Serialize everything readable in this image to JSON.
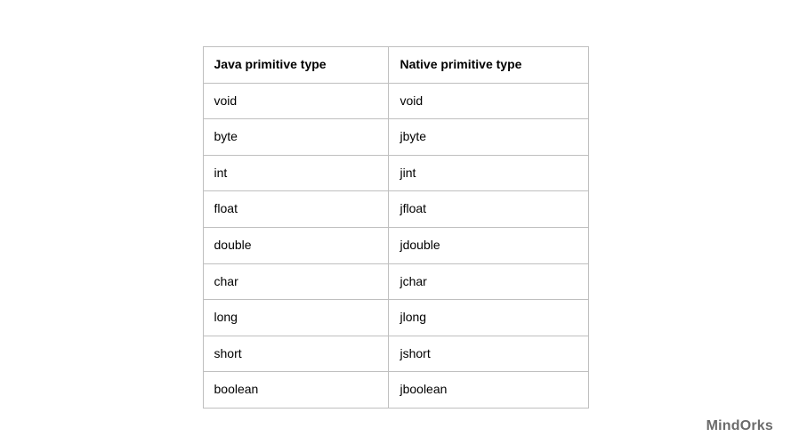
{
  "table": {
    "headers": [
      "Java primitive type",
      "Native primitive type"
    ],
    "rows": [
      {
        "java": "void",
        "native": "void"
      },
      {
        "java": "byte",
        "native": "jbyte"
      },
      {
        "java": "int",
        "native": "jint"
      },
      {
        "java": "float",
        "native": "jfloat"
      },
      {
        "java": "double",
        "native": "jdouble"
      },
      {
        "java": "char",
        "native": "jchar"
      },
      {
        "java": "long",
        "native": "jlong"
      },
      {
        "java": "short",
        "native": "jshort"
      },
      {
        "java": "boolean",
        "native": "jboolean"
      }
    ]
  },
  "footer": {
    "brand": "MindOrks"
  },
  "chart_data": {
    "type": "table",
    "title": "",
    "columns": [
      "Java primitive type",
      "Native primitive type"
    ],
    "rows": [
      [
        "void",
        "void"
      ],
      [
        "byte",
        "jbyte"
      ],
      [
        "int",
        "jint"
      ],
      [
        "float",
        "jfloat"
      ],
      [
        "double",
        "jdouble"
      ],
      [
        "char",
        "jchar"
      ],
      [
        "long",
        "jlong"
      ],
      [
        "short",
        "jshort"
      ],
      [
        "boolean",
        "jboolean"
      ]
    ]
  }
}
